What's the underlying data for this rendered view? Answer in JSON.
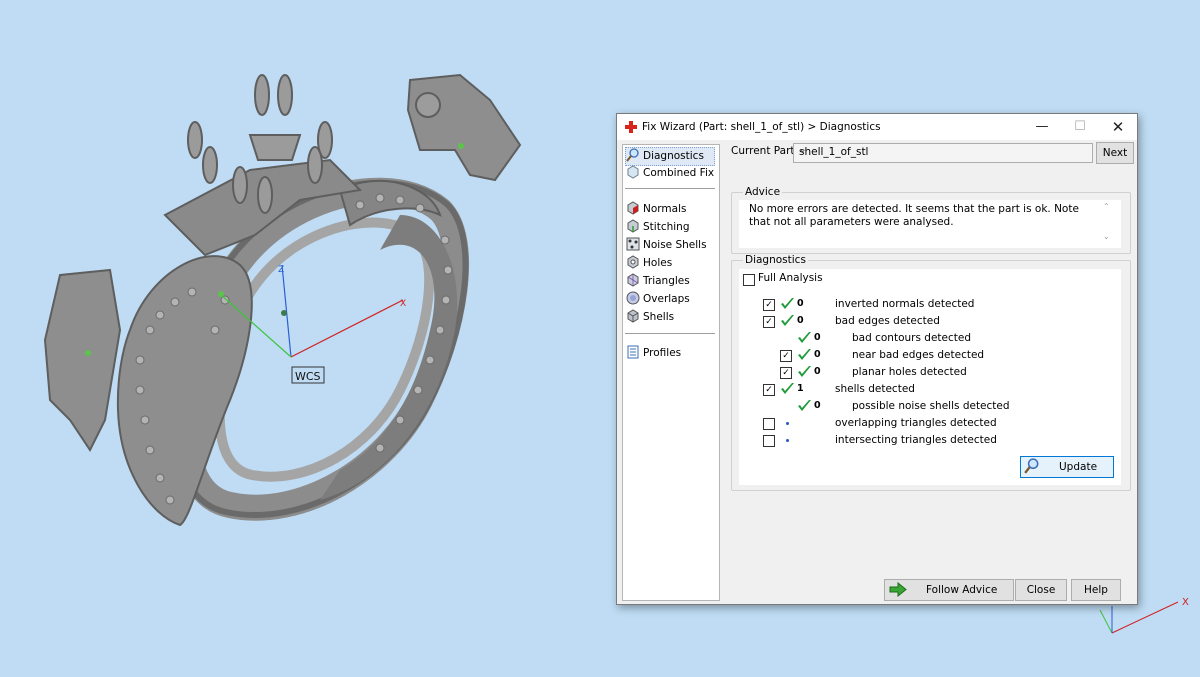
{
  "viewport": {
    "wcs_label": "WCS",
    "axis_z": "Z",
    "axis_x": "X",
    "axis_x_corner": "X"
  },
  "dialog": {
    "title": "Fix Wizard (Part: shell_1_of_stl) > Diagnostics",
    "sidebar": {
      "items": [
        {
          "label": "Diagnostics",
          "icon": "magnifier-icon"
        },
        {
          "label": "Combined Fix",
          "icon": "combined-fix-icon"
        },
        {
          "label": "Normals",
          "icon": "normals-cube-icon"
        },
        {
          "label": "Stitching",
          "icon": "stitching-cube-icon"
        },
        {
          "label": "Noise Shells",
          "icon": "noise-shells-icon"
        },
        {
          "label": "Holes",
          "icon": "holes-cube-icon"
        },
        {
          "label": "Triangles",
          "icon": "triangles-cube-icon"
        },
        {
          "label": "Overlaps",
          "icon": "overlaps-icon"
        },
        {
          "label": "Shells",
          "icon": "shells-cube-icon"
        },
        {
          "label": "Profiles",
          "icon": "profiles-page-icon"
        }
      ]
    },
    "current_part_label": "Current Part:",
    "current_part_value": "shell_1_of_stl",
    "next_label": "Next",
    "advice_title": "Advice",
    "advice_text": "No more errors are detected. It seems that the part is ok. Note that not all parameters were analysed.",
    "diagnostics_title": "Diagnostics",
    "full_analysis_label": "Full Analysis",
    "rows": [
      {
        "label": "inverted normals detected",
        "count": "0",
        "checked": true,
        "tick": true,
        "indent": false
      },
      {
        "label": "bad edges detected",
        "count": "0",
        "checked": true,
        "tick": true,
        "indent": false
      },
      {
        "label": "bad contours detected",
        "count": "0",
        "checked": null,
        "tick": true,
        "indent": true
      },
      {
        "label": "near bad edges detected",
        "count": "0",
        "checked": true,
        "tick": true,
        "indent": true
      },
      {
        "label": "planar holes detected",
        "count": "0",
        "checked": true,
        "tick": true,
        "indent": true
      },
      {
        "label": "shells detected",
        "count": "1",
        "checked": true,
        "tick": true,
        "indent": false
      },
      {
        "label": "possible noise shells detected",
        "count": "0",
        "checked": null,
        "tick": true,
        "indent": true
      },
      {
        "label": "overlapping triangles detected",
        "count": "",
        "checked": false,
        "tick": false,
        "indent": false
      },
      {
        "label": "intersecting triangles detected",
        "count": "",
        "checked": false,
        "tick": false,
        "indent": false
      }
    ],
    "update_label": "Update",
    "follow_advice_label": "Follow Advice",
    "close_label": "Close",
    "help_label": "Help",
    "colors": {
      "tick_green": "#1e9b3a",
      "accent_blue": "#0078d7",
      "title_cross_red": "#d9241c"
    }
  }
}
